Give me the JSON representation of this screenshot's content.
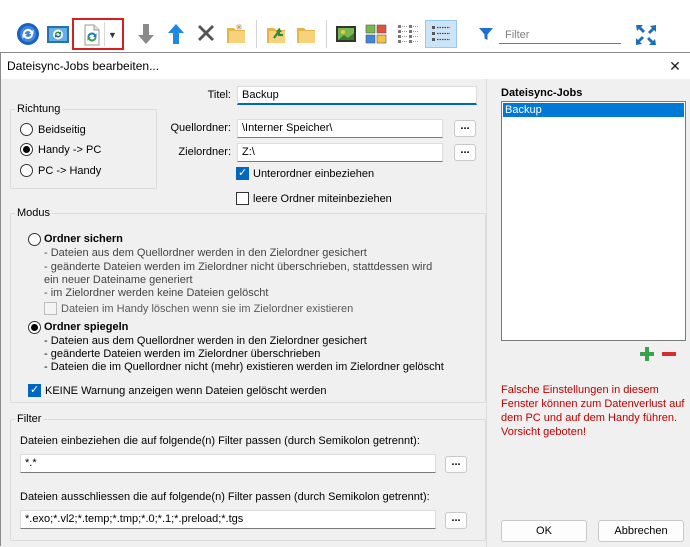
{
  "toolbar": {
    "filter_placeholder": "Filter",
    "icons": [
      "refresh-icon",
      "image-sync-icon",
      "sync-icon",
      "arrow-down-icon",
      "arrow-up-icon",
      "delete-icon",
      "folder-sync-icon",
      "folder-up-icon",
      "folder-icon",
      "view-thumbnails-icon",
      "view-tiles-icon",
      "view-list-icon",
      "view-details-icon",
      "filter-icon",
      "fullscreen-icon"
    ]
  },
  "dialog": {
    "title": "Dateisync-Jobs bearbeiten...",
    "close": "✕",
    "direction": {
      "legend": "Richtung",
      "options": [
        "Beidseitig",
        "Handy -> PC",
        "PC -> Handy"
      ],
      "selected": "Handy -> PC"
    },
    "fields": {
      "title_label": "Titel:",
      "title_value": "Backup",
      "source_label": "Quellordner:",
      "source_value": "\\Interner Speicher\\",
      "target_label": "Zielordner:",
      "target_value": "Z:\\",
      "browse": "...",
      "include_subfolders": "Unterordner einbeziehen",
      "include_empty_folders": "leere Ordner miteinbeziehen"
    },
    "mode": {
      "legend": "Modus",
      "backup_title": "Ordner sichern",
      "backup_lines": [
        "- Dateien aus dem Quellordner werden in den Zielordner gesichert",
        "- geänderte Dateien werden im Zielordner nicht überschrieben, stattdessen wird",
        "ein neuer Dateiname generiert",
        "- im Zielordner werden keine Dateien gelöscht"
      ],
      "delete_on_phone": "Dateien im Handy löschen wenn sie im Zielordner existieren",
      "mirror_title": "Ordner spiegeln",
      "mirror_lines": [
        "- Dateien aus dem Quellordner werden in den Zielordner gesichert",
        "- geänderte Dateien werden im Zielordner überschrieben",
        "- Dateien die im Quellordner nicht (mehr) existieren werden im Zielordner gelöscht"
      ],
      "no_warning": "KEINE Warnung anzeigen wenn Dateien gelöscht werden"
    },
    "filter": {
      "legend": "Filter",
      "include_label": "Dateien einbeziehen die auf folgende(n) Filter passen (durch Semikolon getrennt):",
      "include_value": "*.*",
      "exclude_label": "Dateien ausschliessen die auf folgende(n) Filter passen (durch Semikolon getrennt):",
      "exclude_value": "*.exo;*.vl2;*.temp;*.tmp;*.0;*.1;*.preload;*.tgs"
    },
    "jobs": {
      "heading": "Dateisync-Jobs",
      "items": [
        "Backup"
      ]
    },
    "warning": "Falsche Einstellungen in diesem Fenster können zum Datenverlust auf dem PC und auf dem Handy führen. Vorsicht geboten!",
    "ok": "OK",
    "cancel": "Abbrechen"
  }
}
